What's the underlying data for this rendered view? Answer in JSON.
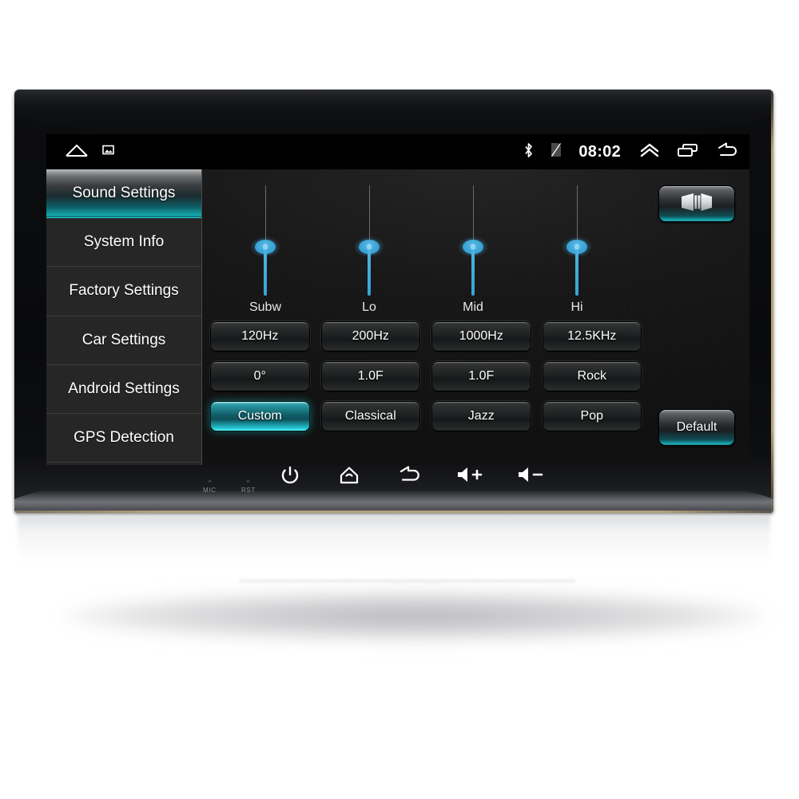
{
  "device": {
    "name": "car-head-unit",
    "screen_label": "android-car-stereo-display"
  },
  "statusbar": {
    "left_icons": [
      {
        "name": "home-outline-icon",
        "glyph": "home"
      },
      {
        "name": "screenshot-icon",
        "glyph": "image"
      }
    ],
    "bluetooth_icon": "bluetooth-icon",
    "sim_icon": "no-sim-icon",
    "time": "08:02",
    "right_icons": [
      {
        "name": "chevron-up-icon",
        "glyph": "double-chevron-up"
      },
      {
        "name": "recent-apps-icon",
        "glyph": "stacked-rectangles"
      },
      {
        "name": "back-icon",
        "glyph": "back-arrow"
      }
    ]
  },
  "sidebar": {
    "items": [
      {
        "label": "Sound Settings",
        "selected": true
      },
      {
        "label": "System Info",
        "selected": false
      },
      {
        "label": "Factory Settings",
        "selected": false
      },
      {
        "label": "Car Settings",
        "selected": false
      },
      {
        "label": "Android Settings",
        "selected": false
      },
      {
        "label": "GPS Detection",
        "selected": false
      }
    ]
  },
  "main": {
    "title": "Sound Settings",
    "sliders": [
      {
        "label": "Subw"
      },
      {
        "label": "Lo"
      },
      {
        "label": "Mid"
      },
      {
        "label": "Hi"
      }
    ],
    "button_grid": [
      {
        "label": "120Hz",
        "active": false
      },
      {
        "label": "200Hz",
        "active": false
      },
      {
        "label": "1000Hz",
        "active": false
      },
      {
        "label": "12.5KHz",
        "active": false
      },
      {
        "label": "0°",
        "active": false
      },
      {
        "label": "1.0F",
        "active": false
      },
      {
        "label": "1.0F",
        "active": false
      },
      {
        "label": "Rock",
        "active": false
      },
      {
        "label": "Custom",
        "active": true
      },
      {
        "label": "Classical",
        "active": false
      },
      {
        "label": "Jazz",
        "active": false
      },
      {
        "label": "Pop",
        "active": false
      }
    ],
    "balance_button": {
      "name": "balance-fade-button",
      "icon": "speaker-balance-icon"
    },
    "default_button": {
      "label": "Default"
    }
  },
  "hardware_keys": [
    {
      "name": "mic-hole",
      "caption": "MIC",
      "type": "hole"
    },
    {
      "name": "reset-hole",
      "caption": "RST",
      "type": "hole"
    },
    {
      "name": "power-key",
      "caption": "",
      "type": "power"
    },
    {
      "name": "home-key",
      "caption": "",
      "type": "home"
    },
    {
      "name": "back-key",
      "caption": "",
      "type": "back"
    },
    {
      "name": "volume-up-key",
      "caption": "",
      "type": "vol-up"
    },
    {
      "name": "volume-down-key",
      "caption": "",
      "type": "vol-down"
    }
  ],
  "colors": {
    "accent_teal": "#1bb6c1",
    "slider_blue": "#3fa6d8",
    "screen_bg": "#151515",
    "sidebar_bg": "#262626",
    "text": "#ffffff"
  }
}
